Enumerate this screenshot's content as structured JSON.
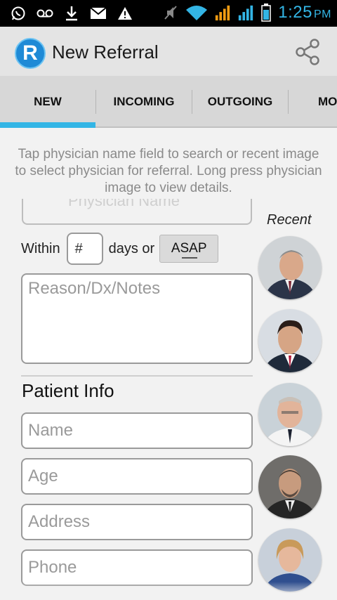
{
  "status_bar": {
    "time": "1:25",
    "ampm": "PM",
    "icons": [
      "whatsapp-icon",
      "voicemail-icon",
      "download-icon",
      "mail-icon",
      "warning-icon",
      "mute-icon",
      "wifi-icon",
      "signal-icon",
      "signal-icon",
      "battery-icon"
    ]
  },
  "app_bar": {
    "title": "New Referral",
    "logo_letter": "R",
    "share_icon": "share-icon"
  },
  "tabs": [
    {
      "label": "NEW",
      "selected": true
    },
    {
      "label": "INCOMING",
      "selected": false
    },
    {
      "label": "OUTGOING",
      "selected": false
    },
    {
      "label": "MO",
      "selected": false
    }
  ],
  "form": {
    "hint": "Tap physician name field to search or recent image to select physician for referral. Long press physician image to view details.",
    "physician_placeholder": "Physician Name",
    "within_label": "Within",
    "days_placeholder": "#",
    "days_or_label": "days or",
    "asap_label": "ASAP",
    "notes_placeholder": "Reason/Dx/Notes",
    "patient_section_title": "Patient Info",
    "patient_fields": [
      "Name",
      "Age",
      "Address",
      "Phone"
    ]
  },
  "recent": {
    "label": "Recent",
    "physicians": [
      {
        "photo": "physician-photo-1"
      },
      {
        "photo": "physician-photo-2"
      },
      {
        "photo": "physician-photo-3"
      },
      {
        "photo": "physician-photo-4"
      },
      {
        "photo": "physician-photo-5"
      }
    ]
  },
  "colors": {
    "accent": "#33b5e5",
    "logo_blue": "#1f8ad6",
    "tab_bg": "#d7d7d7",
    "app_bar_bg": "#e4e4e4"
  }
}
